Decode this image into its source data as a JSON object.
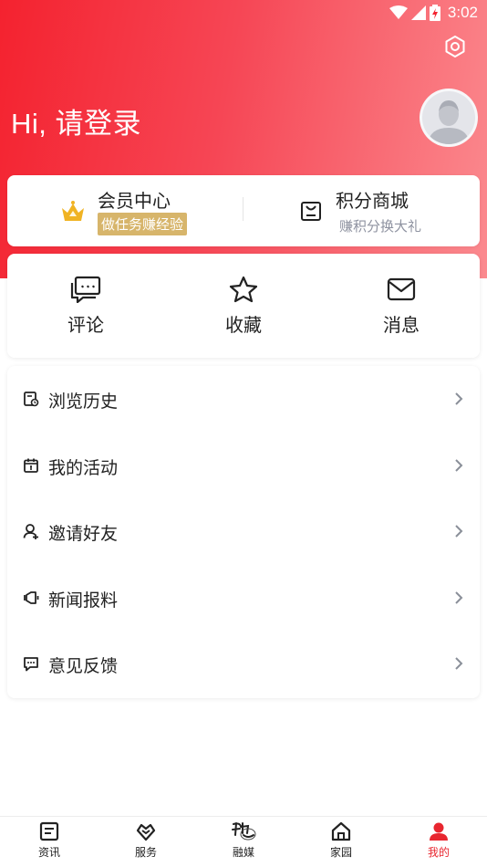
{
  "status_bar": {
    "time": "3:02"
  },
  "header": {
    "greeting": "Hi, 请登录"
  },
  "vip": {
    "member_title": "会员中心",
    "member_subtitle": "做任务赚经验",
    "points_title": "积分商城",
    "points_subtitle": "赚积分换大礼"
  },
  "quick_actions": [
    {
      "label": "评论",
      "icon": "comment-icon"
    },
    {
      "label": "收藏",
      "icon": "star-icon"
    },
    {
      "label": "消息",
      "icon": "mail-icon"
    }
  ],
  "menu": [
    {
      "label": "浏览历史",
      "icon": "history-icon"
    },
    {
      "label": "我的活动",
      "icon": "calendar-icon"
    },
    {
      "label": "邀请好友",
      "icon": "invite-user-icon"
    },
    {
      "label": "新闻报料",
      "icon": "news-tip-icon"
    },
    {
      "label": "意见反馈",
      "icon": "feedback-icon"
    }
  ],
  "tabs": [
    {
      "label": "资讯",
      "icon": "news-icon",
      "active": false
    },
    {
      "label": "服务",
      "icon": "service-icon",
      "active": false
    },
    {
      "label": "融媒",
      "icon": "media-logo-icon",
      "active": false
    },
    {
      "label": "家园",
      "icon": "home-icon",
      "active": false
    },
    {
      "label": "我的",
      "icon": "profile-icon",
      "active": true
    }
  ],
  "colors": {
    "brand_red": "#f4222f",
    "active_tab": "#e8262f",
    "vip_gold": "#d7b56b"
  }
}
